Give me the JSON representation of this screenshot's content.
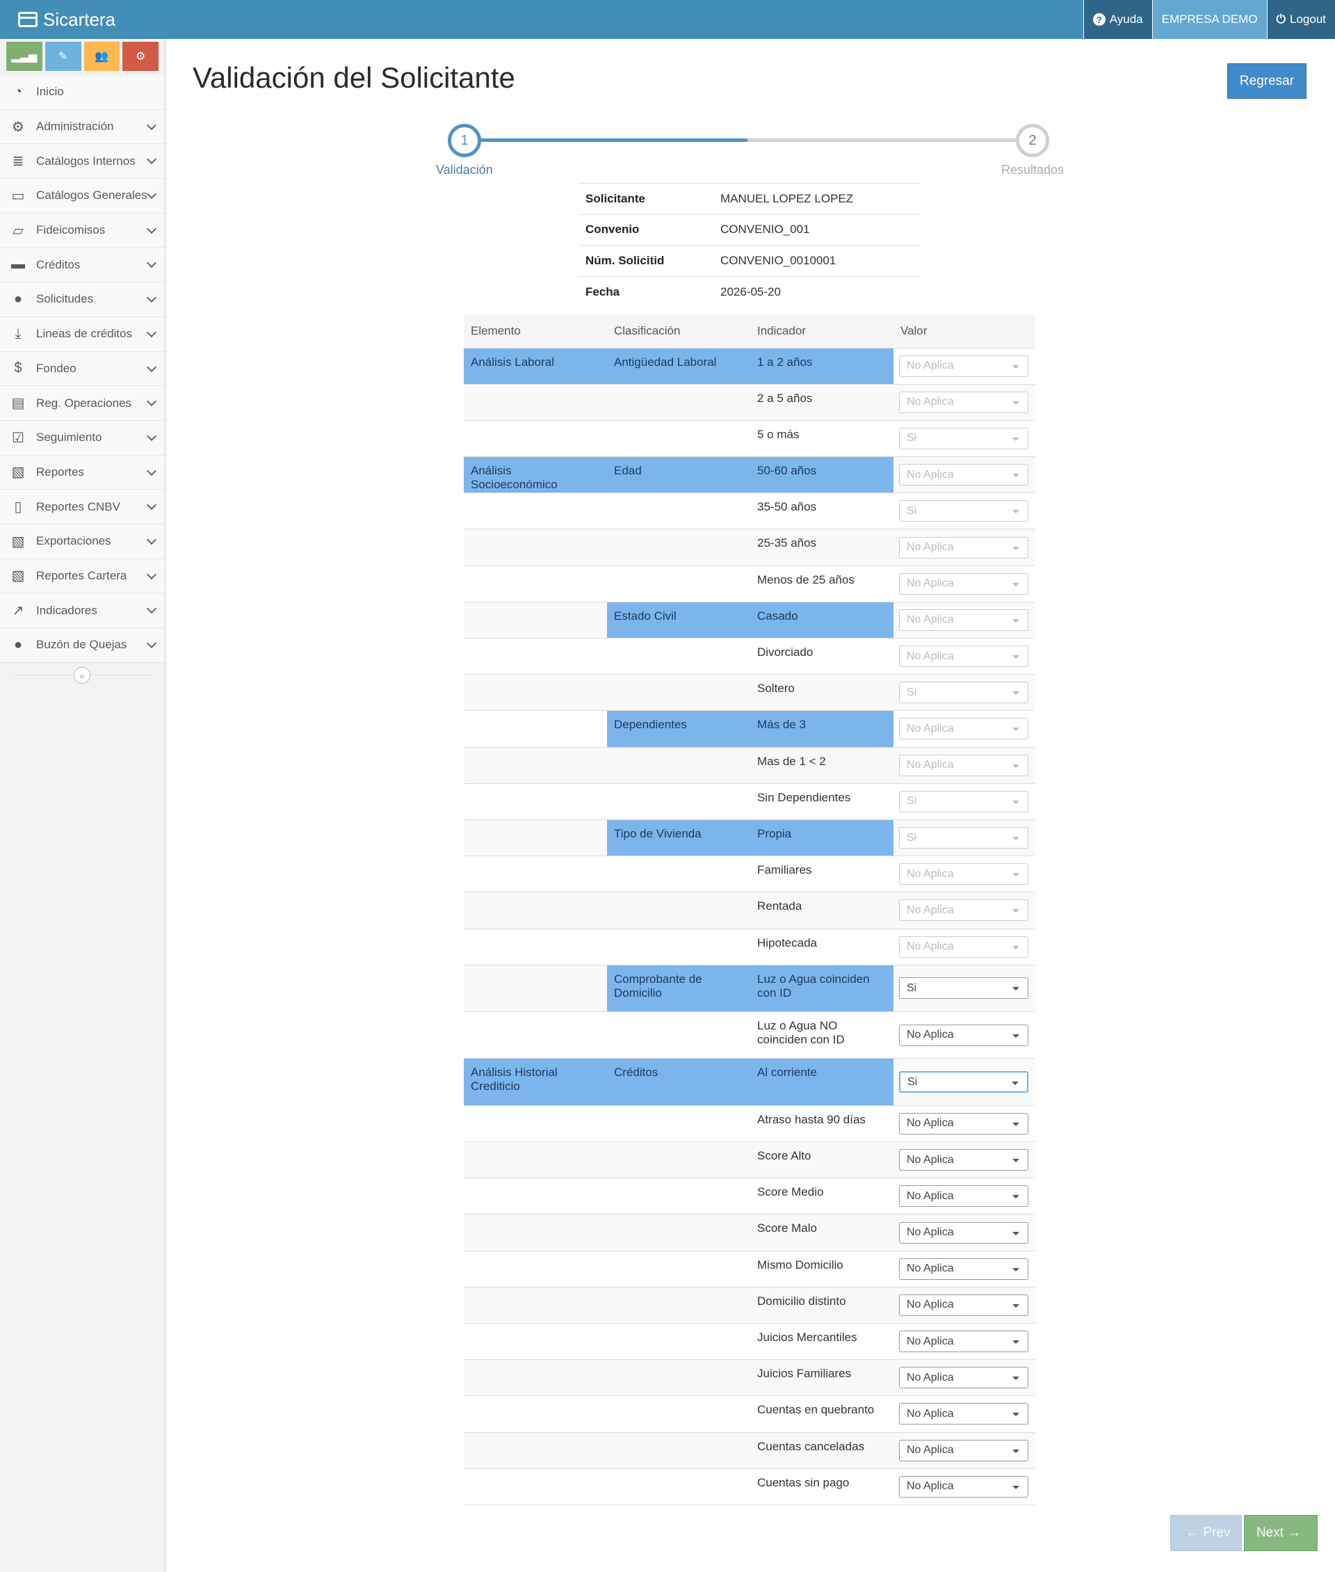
{
  "navbar": {
    "brand": "Sicartera",
    "help_label": "Ayuda",
    "company_label": "EMPRESA DEMO",
    "logout_label": "Logout"
  },
  "sidebar": {
    "items": [
      {
        "label": "Inicio",
        "icon": "dashboard-icon"
      },
      {
        "label": "Administración",
        "icon": "gears-icon"
      },
      {
        "label": "Catálogos Internos",
        "icon": "database-icon"
      },
      {
        "label": "Catálogos Generales",
        "icon": "desktop-icon"
      },
      {
        "label": "Fideicomisos",
        "icon": "folder-open-icon"
      },
      {
        "label": "Créditos",
        "icon": "briefcase-icon"
      },
      {
        "label": "Solicitudes",
        "icon": "user-icon"
      },
      {
        "label": "Lineas de créditos",
        "icon": "download-icon"
      },
      {
        "label": "Fondeo",
        "icon": "dollar-icon"
      },
      {
        "label": "Reg. Operaciones",
        "icon": "file-text-icon"
      },
      {
        "label": "Seguimiento",
        "icon": "check-square-icon"
      },
      {
        "label": "Reportes",
        "icon": "file-excel-icon"
      },
      {
        "label": "Reportes CNBV",
        "icon": "file-icon"
      },
      {
        "label": "Exportaciones",
        "icon": "file-excel-icon"
      },
      {
        "label": "Reportes Cartera",
        "icon": "file-excel-icon"
      },
      {
        "label": "Indicadores",
        "icon": "line-chart-icon"
      },
      {
        "label": "Buzón de Quejas",
        "icon": "comment-icon"
      }
    ]
  },
  "page": {
    "title": "Validación del Solicitante",
    "back_label": "Regresar"
  },
  "wizard": {
    "progress_percent": 50,
    "steps": [
      {
        "num": "1",
        "label": "Validación"
      },
      {
        "num": "2",
        "label": "Resultados"
      }
    ]
  },
  "info": [
    {
      "key": "Solicitante",
      "value": "MANUEL LOPEZ LOPEZ"
    },
    {
      "key": "Convenio",
      "value": "CONVENIO_001"
    },
    {
      "key": "Núm. Solicitid",
      "value": "CONVENIO_0010001"
    },
    {
      "key": "Fecha",
      "value": "2026-05-20"
    }
  ],
  "table": {
    "headers": [
      "Elemento",
      "Clasificación",
      "Indicador",
      "Valor"
    ],
    "rows": [
      {
        "elemento": "Análisis Laboral",
        "clasificacion": "Antigüedad Laboral",
        "indicador": "1 a 2 años",
        "valor": "No Aplica"
      },
      {
        "elemento": "",
        "clasificacion": "",
        "indicador": "2 a 5 años",
        "valor": "No Aplica"
      },
      {
        "elemento": "",
        "clasificacion": "",
        "indicador": "5 o más",
        "valor": "Si"
      },
      {
        "elemento": "Análisis Socioeconómico",
        "clasificacion": "Edad",
        "indicador": "50-60 años",
        "valor": "No Aplica"
      },
      {
        "elemento": "",
        "clasificacion": "",
        "indicador": "35-50 años",
        "valor": "Si"
      },
      {
        "elemento": "",
        "clasificacion": "",
        "indicador": "25-35 años",
        "valor": "No Aplica"
      },
      {
        "elemento": "",
        "clasificacion": "",
        "indicador": "Menos de 25 años",
        "valor": "No Aplica"
      },
      {
        "elemento": "",
        "clasificacion": "Estado Civil",
        "indicador": "Casado",
        "valor": "No Aplica"
      },
      {
        "elemento": "",
        "clasificacion": "",
        "indicador": "Divorciado",
        "valor": "No Aplica"
      },
      {
        "elemento": "",
        "clasificacion": "",
        "indicador": "Soltero",
        "valor": "Si"
      },
      {
        "elemento": "",
        "clasificacion": "Dependientes",
        "indicador": "Más de 3",
        "valor": "No Aplica"
      },
      {
        "elemento": "",
        "clasificacion": "",
        "indicador": "Mas de 1 < 2",
        "valor": "No Aplica"
      },
      {
        "elemento": "",
        "clasificacion": "",
        "indicador": "Sin Dependientes",
        "valor": "Si"
      },
      {
        "elemento": "",
        "clasificacion": "Tipo de Vivienda",
        "indicador": "Propia",
        "valor": "Si"
      },
      {
        "elemento": "",
        "clasificacion": "",
        "indicador": "Familiares",
        "valor": "No Aplica"
      },
      {
        "elemento": "",
        "clasificacion": "",
        "indicador": "Rentada",
        "valor": "No Aplica"
      },
      {
        "elemento": "",
        "clasificacion": "",
        "indicador": "Hipotecada",
        "valor": "No Aplica"
      },
      {
        "elemento": "",
        "clasificacion": "Comprobante de Domicilio",
        "indicador": "Luz o Agua coinciden con ID",
        "valor": "Si"
      },
      {
        "elemento": "",
        "clasificacion": "",
        "indicador": "Luz o Agua NO coinciden con ID",
        "valor": "No Aplica"
      },
      {
        "elemento": "Análisis Historial Crediticio",
        "clasificacion": "Créditos",
        "indicador": "Al corriente",
        "valor": "Si"
      },
      {
        "elemento": "",
        "clasificacion": "",
        "indicador": "Atraso hasta 90 días",
        "valor": "No Aplica"
      },
      {
        "elemento": "",
        "clasificacion": "",
        "indicador": "Score Alto",
        "valor": "No Aplica"
      },
      {
        "elemento": "",
        "clasificacion": "",
        "indicador": "Score Medio",
        "valor": "No Aplica"
      },
      {
        "elemento": "",
        "clasificacion": "",
        "indicador": "Score Malo",
        "valor": "No Aplica"
      },
      {
        "elemento": "",
        "clasificacion": "",
        "indicador": "Mismo Domicilio",
        "valor": "No Aplica"
      },
      {
        "elemento": "",
        "clasificacion": "",
        "indicador": "Domicilio distinto",
        "valor": "No Aplica"
      },
      {
        "elemento": "",
        "clasificacion": "",
        "indicador": "Juicios Mercantiles",
        "valor": "No Aplica"
      },
      {
        "elemento": "",
        "clasificacion": "",
        "indicador": "Juicios Familiares",
        "valor": "No Aplica"
      },
      {
        "elemento": "",
        "clasificacion": "",
        "indicador": "Cuentas en quebranto",
        "valor": "No Aplica"
      },
      {
        "elemento": "",
        "clasificacion": "",
        "indicador": "Cuentas canceladas",
        "valor": "No Aplica"
      },
      {
        "elemento": "",
        "clasificacion": "",
        "indicador": "Cuentas sin pago",
        "valor": "No Aplica"
      }
    ]
  },
  "pager": {
    "prev_label": "Prev",
    "next_label": "Next"
  }
}
